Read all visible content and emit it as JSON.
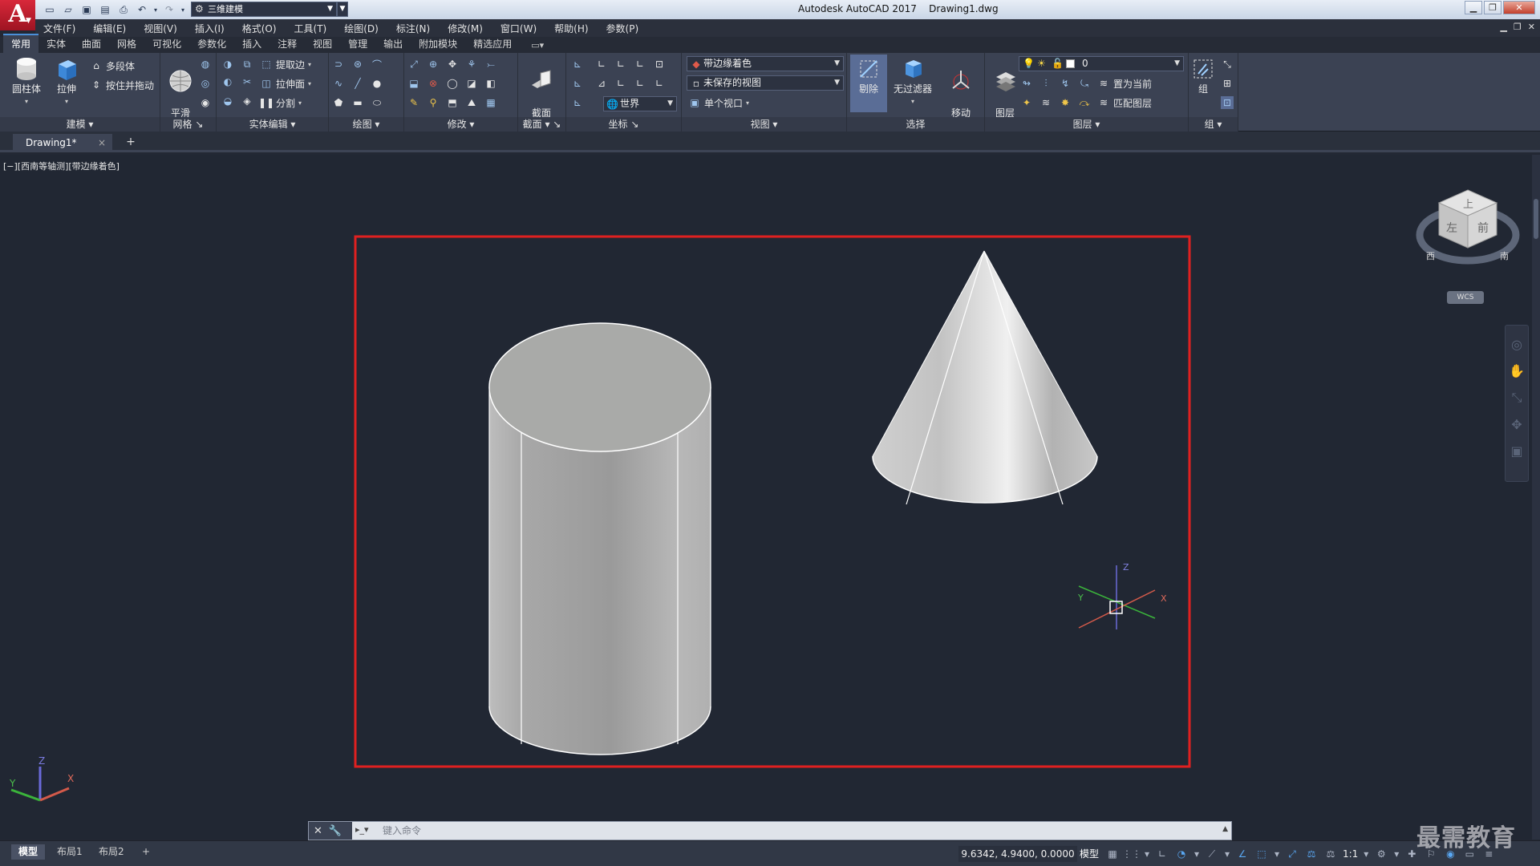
{
  "app": {
    "logo_letter": "A",
    "title": "Autodesk AutoCAD 2017    Drawing1.dwg",
    "workspace": "三维建模"
  },
  "menubar": [
    "文件(F)",
    "编辑(E)",
    "视图(V)",
    "插入(I)",
    "格式(O)",
    "工具(T)",
    "绘图(D)",
    "标注(N)",
    "修改(M)",
    "窗口(W)",
    "帮助(H)",
    "参数(P)"
  ],
  "ribbon_tabs": [
    "常用",
    "实体",
    "曲面",
    "网格",
    "可视化",
    "参数化",
    "插入",
    "注释",
    "视图",
    "管理",
    "输出",
    "附加模块",
    "精选应用"
  ],
  "ribbon": {
    "modeling": {
      "title": "建模",
      "cylinder": "圆柱体",
      "extrude": "拉伸",
      "polysolid": "多段体",
      "presspull": "按住并拖动"
    },
    "mesh": {
      "title": "网格",
      "smooth": "平滑\n对象"
    },
    "solid_edit": {
      "title": "实体编辑",
      "extract_edges": "提取边",
      "extrude_faces": "拉伸面",
      "separate": "分割"
    },
    "draw": {
      "title": "绘图"
    },
    "modify": {
      "title": "修改"
    },
    "section": {
      "title": "截面",
      "plane": "截面\n平面"
    },
    "coords": {
      "title": "坐标",
      "world": "世界"
    },
    "view": {
      "title": "视图",
      "visual_style": "带边缘着色",
      "saved_view": "未保存的视图",
      "viewport": "单个视口"
    },
    "selection": {
      "title": "选择",
      "cull": "剔除",
      "no_filter": "无过滤器",
      "gizmo": "移动\n小控件"
    },
    "layers": {
      "title": "图层",
      "layer_props": "图层\n特性",
      "layer_name": "0",
      "set_current": "置为当前",
      "match_layer": "匹配图层"
    },
    "groups": {
      "title": "组",
      "group": "组"
    }
  },
  "doc_tab": {
    "name": "Drawing1*",
    "close": "×",
    "new": "+"
  },
  "viewport": {
    "label": "[−][西南等轴测][带边缘着色]",
    "viewcube": {
      "top": "上",
      "left": "左",
      "front": "前",
      "west": "西",
      "south": "南"
    },
    "wcs": "WCS",
    "ucs_x": "X",
    "ucs_y": "Y",
    "ucs_z": "Z",
    "highlight_color": "#e02020"
  },
  "command_line": {
    "placeholder": "键入命令"
  },
  "statusbar": {
    "layout_tabs": [
      "模型",
      "布局1",
      "布局2"
    ],
    "add_layout": "+",
    "coords": "9.6342, 4.9400, 0.0000",
    "model": "模型",
    "scale": "1:1"
  },
  "watermark": "最需教育"
}
